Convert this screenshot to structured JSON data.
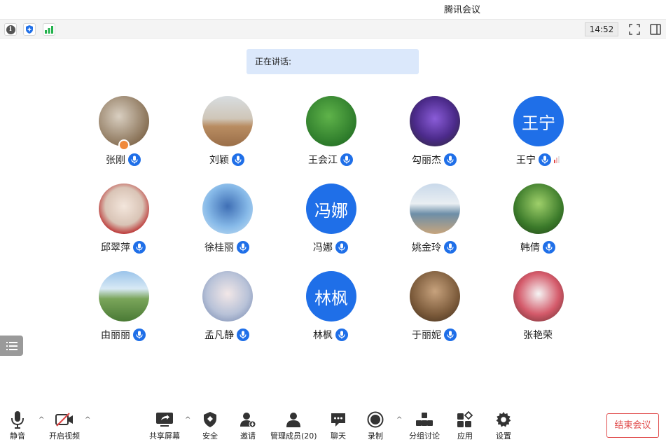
{
  "window": {
    "title": "腾讯会议"
  },
  "infobar": {
    "clock": "14:52"
  },
  "speaking": {
    "label": "正在讲话:"
  },
  "participants": [
    {
      "name": "张刚",
      "avatar": "photo",
      "host": true
    },
    {
      "name": "刘颖",
      "avatar": "photo"
    },
    {
      "name": "王会江",
      "avatar": "photo"
    },
    {
      "name": "勾丽杰",
      "avatar": "photo"
    },
    {
      "name": "王宁",
      "avatar_text": "王宁",
      "signal": true
    },
    {
      "name": "邱翠萍",
      "avatar": "photo"
    },
    {
      "name": "徐桂丽",
      "avatar": "photo"
    },
    {
      "name": "冯娜",
      "avatar_text": "冯娜"
    },
    {
      "name": "姚金玲",
      "avatar": "photo"
    },
    {
      "name": "韩倩",
      "avatar": "photo"
    },
    {
      "name": "由丽丽",
      "avatar": "photo"
    },
    {
      "name": "孟凡静",
      "avatar": "photo"
    },
    {
      "name": "林枫",
      "avatar_text": "林枫"
    },
    {
      "name": "于丽妮",
      "avatar": "photo"
    },
    {
      "name": "张艳荣",
      "avatar": "photo",
      "no_mic": true
    }
  ],
  "toolbar": {
    "mute": "静音",
    "video": "开启视频",
    "share": "共享屏幕",
    "security": "安全",
    "invite": "邀请",
    "members": "管理成员(20)",
    "chat": "聊天",
    "record": "录制",
    "breakout": "分组讨论",
    "apps": "应用",
    "settings": "设置",
    "end": "结束会议"
  },
  "colors": {
    "accent": "#1f6fe8",
    "danger": "#e04b4b"
  }
}
